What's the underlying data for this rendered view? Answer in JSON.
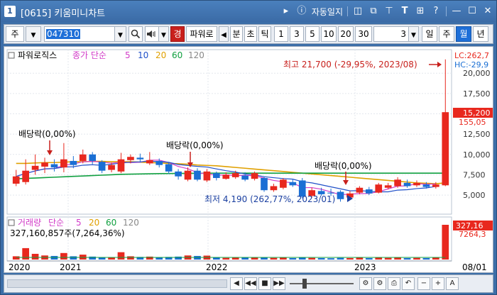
{
  "window": {
    "number": "1",
    "title": "[0615] 키움미니차트",
    "autosave_label": "자동일지"
  },
  "toolbar": {
    "market": "주",
    "code": "047310",
    "view_badge": "경",
    "stock_name": "파워로",
    "periods": [
      "분",
      "초",
      "틱"
    ],
    "numbers": [
      "1",
      "3",
      "5",
      "10",
      "20",
      "30"
    ],
    "count_value": "3",
    "units": [
      "일",
      "주",
      "월",
      "년"
    ],
    "active_unit": "월"
  },
  "price_panel": {
    "name_label": "파워로직스",
    "ma_label": "종가 단순",
    "ma_periods": [
      "5",
      "10",
      "20",
      "60",
      "120"
    ],
    "lc_label": "LC:262,7",
    "lc_sub": "-29,95",
    "hc_label": "HC:-29,9",
    "current_price": "15,200",
    "current_sub": "155,05",
    "yticks": [
      "20,000",
      "17,500",
      "15,000",
      "12,500",
      "10,000",
      "7,500",
      "5,000"
    ],
    "high_annotation": "최고 21,700 (-29,95%, 2023/08)",
    "low_annotation": "최저 4,190 (262,77%, 2023/01)",
    "dividend_labels": [
      "배당락(0,00%)",
      "배당락(0,00%)",
      "배당락(0,00%)"
    ]
  },
  "volume_panel": {
    "name_label": "거래량",
    "ma_label": "단순",
    "ma_periods": [
      "5",
      "20",
      "60",
      "120"
    ],
    "value_label": "327,160,857주(7,264,36%)",
    "current_value": "327,16",
    "current_sub": "7264,3"
  },
  "xaxis": {
    "labels": [
      "2020",
      "2021",
      "2022",
      "2023"
    ],
    "right_label": "08/01"
  },
  "colors": {
    "up": "#e8281e",
    "down": "#1a6fd4",
    "ma5": "#d23cc8",
    "ma10": "#2050c8",
    "ma20": "#e0a000",
    "ma60": "#10a040",
    "ma120": "#888888"
  },
  "chart_data": {
    "type": "candlestick",
    "title": "파워로직스",
    "ylabel": "",
    "ylim": [
      3000,
      21500
    ],
    "candles": [
      {
        "o": 6400,
        "c": 7300,
        "h": 8100,
        "l": 6100,
        "v": 20
      },
      {
        "o": 6600,
        "c": 8000,
        "h": 9400,
        "l": 6300,
        "v": 70
      },
      {
        "o": 8100,
        "c": 8600,
        "h": 10000,
        "l": 7500,
        "v": 35
      },
      {
        "o": 8500,
        "c": 9000,
        "h": 9600,
        "l": 7700,
        "v": 25
      },
      {
        "o": 8800,
        "c": 8400,
        "h": 9400,
        "l": 7900,
        "v": 22
      },
      {
        "o": 8400,
        "c": 9400,
        "h": 11400,
        "l": 7800,
        "v": 40
      },
      {
        "o": 9200,
        "c": 8700,
        "h": 9800,
        "l": 8300,
        "v": 20
      },
      {
        "o": 9200,
        "c": 10000,
        "h": 10600,
        "l": 8900,
        "v": 30
      },
      {
        "o": 10000,
        "c": 9200,
        "h": 10300,
        "l": 8800,
        "v": 18
      },
      {
        "o": 9100,
        "c": 8000,
        "h": 9300,
        "l": 7700,
        "v": 15
      },
      {
        "o": 8100,
        "c": 8700,
        "h": 9000,
        "l": 7800,
        "v": 14
      },
      {
        "o": 7900,
        "c": 9400,
        "h": 10200,
        "l": 7700,
        "v": 45
      },
      {
        "o": 9300,
        "c": 9700,
        "h": 10000,
        "l": 8900,
        "v": 20
      },
      {
        "o": 9600,
        "c": 9400,
        "h": 10100,
        "l": 9000,
        "v": 16
      },
      {
        "o": 8900,
        "c": 9300,
        "h": 10300,
        "l": 8700,
        "v": 18
      },
      {
        "o": 9200,
        "c": 8700,
        "h": 9500,
        "l": 8400,
        "v": 14
      },
      {
        "o": 8800,
        "c": 7900,
        "h": 9000,
        "l": 7600,
        "v": 16
      },
      {
        "o": 7900,
        "c": 7300,
        "h": 8200,
        "l": 6900,
        "v": 18
      },
      {
        "o": 6900,
        "c": 8000,
        "h": 8400,
        "l": 6700,
        "v": 25
      },
      {
        "o": 8000,
        "c": 6900,
        "h": 8300,
        "l": 6700,
        "v": 22
      },
      {
        "o": 6800,
        "c": 7900,
        "h": 8200,
        "l": 6600,
        "v": 24
      },
      {
        "o": 7700,
        "c": 7100,
        "h": 7900,
        "l": 6800,
        "v": 12
      },
      {
        "o": 7000,
        "c": 7500,
        "h": 7800,
        "l": 6900,
        "v": 10
      },
      {
        "o": 7200,
        "c": 7700,
        "h": 8000,
        "l": 7000,
        "v": 12
      },
      {
        "o": 7400,
        "c": 6900,
        "h": 7800,
        "l": 6700,
        "v": 11
      },
      {
        "o": 7000,
        "c": 7700,
        "h": 7900,
        "l": 6800,
        "v": 12
      },
      {
        "o": 7100,
        "c": 5600,
        "h": 7300,
        "l": 5400,
        "v": 14
      },
      {
        "o": 5600,
        "c": 6100,
        "h": 6400,
        "l": 5400,
        "v": 10
      },
      {
        "o": 5900,
        "c": 6900,
        "h": 7100,
        "l": 5700,
        "v": 12
      },
      {
        "o": 6600,
        "c": 6200,
        "h": 6900,
        "l": 6000,
        "v": 9
      },
      {
        "o": 6800,
        "c": 4800,
        "h": 7100,
        "l": 4600,
        "v": 13
      },
      {
        "o": 4900,
        "c": 5600,
        "h": 5900,
        "l": 4700,
        "v": 10
      },
      {
        "o": 5500,
        "c": 5100,
        "h": 5900,
        "l": 4900,
        "v": 9
      },
      {
        "o": 5300,
        "c": 5200,
        "h": 5800,
        "l": 4900,
        "v": 8
      },
      {
        "o": 5400,
        "c": 4500,
        "h": 5600,
        "l": 4190,
        "v": 10
      },
      {
        "o": 4700,
        "c": 5200,
        "h": 5500,
        "l": 4500,
        "v": 9
      },
      {
        "o": 5300,
        "c": 5900,
        "h": 6100,
        "l": 5100,
        "v": 11
      },
      {
        "o": 5700,
        "c": 5200,
        "h": 6000,
        "l": 5000,
        "v": 9
      },
      {
        "o": 5300,
        "c": 6300,
        "h": 6500,
        "l": 5200,
        "v": 12
      },
      {
        "o": 5900,
        "c": 6200,
        "h": 6500,
        "l": 5700,
        "v": 10
      },
      {
        "o": 6100,
        "c": 6900,
        "h": 7200,
        "l": 5900,
        "v": 13
      },
      {
        "o": 6500,
        "c": 6100,
        "h": 6900,
        "l": 5900,
        "v": 9
      },
      {
        "o": 6200,
        "c": 6500,
        "h": 6800,
        "l": 6000,
        "v": 10
      },
      {
        "o": 6300,
        "c": 6000,
        "h": 6600,
        "l": 5800,
        "v": 9
      },
      {
        "o": 6000,
        "c": 6300,
        "h": 6600,
        "l": 5800,
        "v": 12
      },
      {
        "o": 6200,
        "c": 15200,
        "h": 21700,
        "l": 6100,
        "v": 200
      }
    ],
    "ma_lines": {
      "ma20": [
        8900,
        8900,
        8950,
        9000,
        9000,
        9050,
        9100,
        9100,
        9150,
        9150,
        9100,
        9100,
        9100,
        9050,
        9000,
        8950,
        8900,
        8850,
        8800,
        8700,
        8650,
        8600,
        8500,
        8400,
        8300,
        8200,
        8100,
        8000,
        7900,
        7800,
        7700,
        7600,
        7500,
        7400,
        7300,
        7200,
        7100,
        7000,
        6900,
        6800,
        6700,
        6600,
        6500,
        6450,
        6400,
        6500
      ],
      "ma60": [
        7000,
        7050,
        7100,
        7150,
        7200,
        7250,
        7300,
        7350,
        7400,
        7450,
        7500,
        7550,
        7580,
        7600,
        7620,
        7640,
        7650,
        7660,
        7670,
        7680,
        7690,
        7700,
        7700,
        7700,
        7700,
        7700,
        7700,
        7700,
        7700,
        7700,
        7700,
        7700,
        7700,
        7700,
        7700,
        7700,
        7700,
        7700,
        7700,
        7700,
        7700,
        7700,
        7700,
        7700,
        7700,
        7700
      ]
    }
  }
}
